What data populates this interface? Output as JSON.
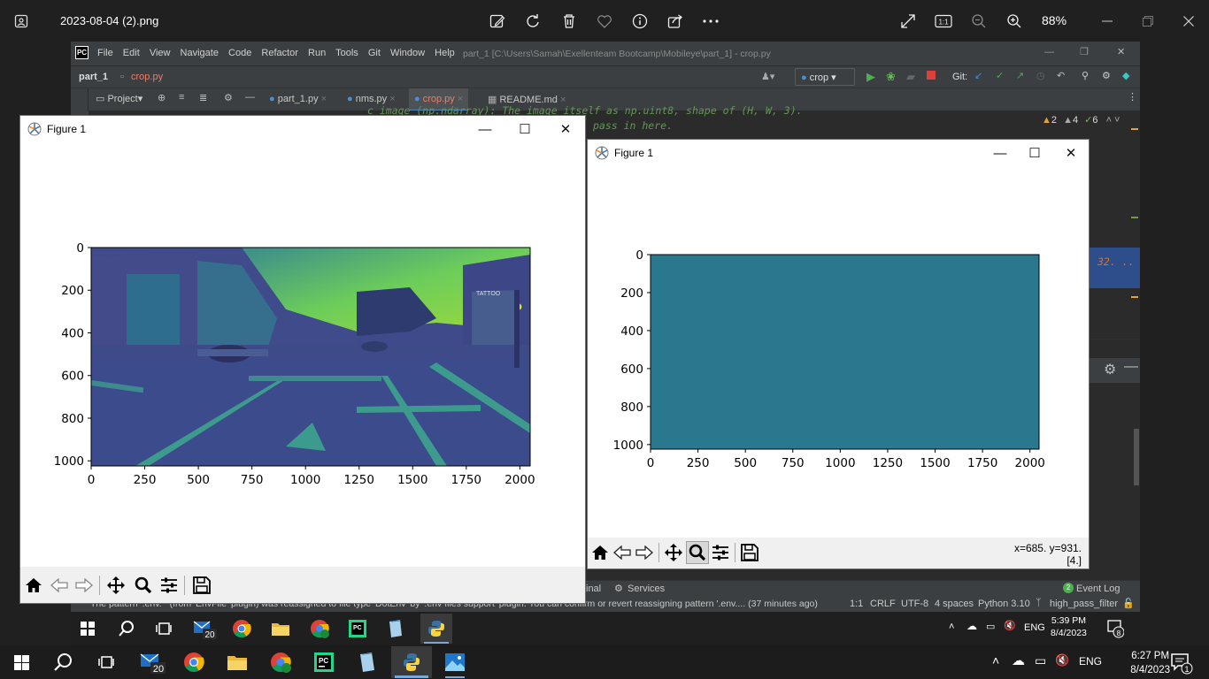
{
  "viewer": {
    "title": "2023-08-04 (2).png",
    "zoom": "88%",
    "icons": [
      "photos-app-icon",
      "edit-image-icon",
      "rotate-icon",
      "delete-icon",
      "favorite-icon",
      "info-icon",
      "share-icon",
      "more-icon",
      "fullscreen-icon",
      "actual-size-icon",
      "zoom-out-icon",
      "zoom-in-icon",
      "minimize-icon",
      "restore-icon",
      "close-icon"
    ],
    "actual_size_label": "1:1"
  },
  "ide": {
    "logo": "PC",
    "menu": [
      "File",
      "Edit",
      "View",
      "Navigate",
      "Code",
      "Refactor",
      "Run",
      "Tools",
      "Git",
      "Window",
      "Help"
    ],
    "window_title": "part_1 [C:\\Users\\Samah\\Exellenteam Bootcamp\\Mobileye\\part_1] - crop.py",
    "breadcrumb_project": "part_1",
    "breadcrumb_file": "crop.py",
    "run_config": "crop",
    "git_label": "Git:",
    "project_panel_label": "Project",
    "side_label": "roject",
    "tabs": [
      "part_1.py",
      "nms.py",
      "crop.py",
      "README.md"
    ],
    "code_line1": "c_image (np.ndarray): The image itself as np.uint8, shape of (H, W, 3).",
    "code_line2": "pass in here.",
    "code_fragment": "32. ..",
    "inspections": {
      "warnings": "2",
      "weak": "4",
      "ok": "6"
    },
    "bottom_tabs": {
      "terminal": "inal",
      "services": "Services",
      "event_log": "Event Log",
      "event_count": "2"
    },
    "status_message": "The pattern '.env.*' (from 'EnvFile' plugin) was reassigned to file type 'DotEnv' by '.env files support' plugin. You can confirm or revert reassigning pattern '.env.... (37 minutes ago)",
    "status_items": [
      "1:1",
      "CRLF",
      "UTF-8",
      "4 spaces",
      "Python 3.10"
    ],
    "branch": "high_pass_filter"
  },
  "inner_taskbar": {
    "mail_badge": "20",
    "lang": "ENG",
    "time": "5:39 PM",
    "date": "8/4/2023",
    "notif_count": "8"
  },
  "figure_left": {
    "title": "Figure 1",
    "chart_data": {
      "type": "heatmap",
      "description_colormap": "viridis",
      "xticks": [
        "0",
        "250",
        "500",
        "750",
        "1000",
        "1250",
        "1500",
        "1750",
        "2000"
      ],
      "yticks": [
        "0",
        "200",
        "400",
        "600",
        "800",
        "1000"
      ],
      "xlim": [
        0,
        2048
      ],
      "ylim": [
        1024,
        0
      ]
    }
  },
  "figure_right": {
    "title": "Figure 1",
    "coords": "x=685. y=931.",
    "value": "[4.]",
    "fill_color": "#2a788e",
    "chart_data": {
      "type": "heatmap",
      "xticks": [
        "0",
        "250",
        "500",
        "750",
        "1000",
        "1250",
        "1500",
        "1750",
        "2000"
      ],
      "yticks": [
        "0",
        "200",
        "400",
        "600",
        "800",
        "1000"
      ],
      "xlim": [
        0,
        2048
      ],
      "ylim": [
        1024,
        0
      ]
    }
  },
  "taskbar": {
    "mail_badge": "20",
    "lang": "ENG",
    "time": "6:27 PM",
    "date": "8/4/2023",
    "notif_count": "1"
  }
}
